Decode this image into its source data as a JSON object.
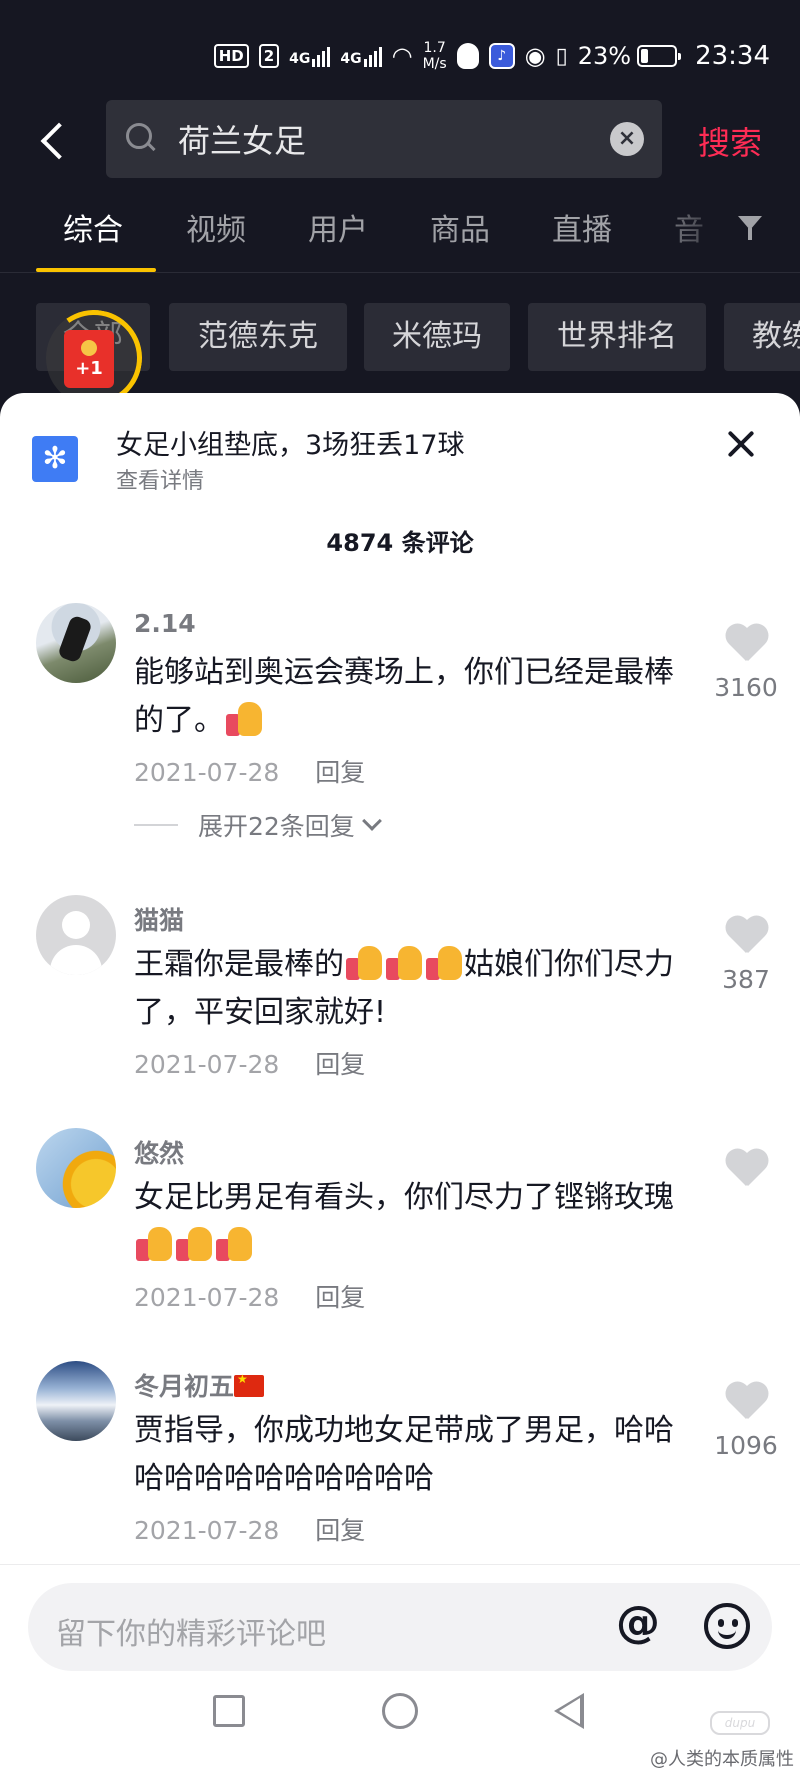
{
  "status_bar": {
    "hd": "HD",
    "sim": "2",
    "sig1": "4G",
    "sig2": "4G",
    "speed_val": "1.7",
    "speed_unit": "M/s",
    "battery": "23%",
    "battery_level": 0.23,
    "time": "23:34"
  },
  "search": {
    "query": "荷兰女足",
    "button_label": "搜索"
  },
  "tabs": [
    {
      "label": "综合",
      "active": true
    },
    {
      "label": "视频"
    },
    {
      "label": "用户"
    },
    {
      "label": "商品"
    },
    {
      "label": "直播"
    },
    {
      "label": "音"
    }
  ],
  "chips": [
    "全部",
    "范德东克",
    "米德玛",
    "世界排名",
    "教练"
  ],
  "red_packet": {
    "label": "+1"
  },
  "sheet": {
    "topic_title": "女足小组垫底，3场狂丢17球",
    "topic_sub": "查看详情",
    "comment_count": "4874 条评论",
    "comments": [
      {
        "user": "2.14",
        "text": "能够站到奥运会赛场上，你们已经是最棒的了。",
        "date": "2021-07-28",
        "reply": "回复",
        "likes": "3160",
        "expand": "展开22条回复"
      },
      {
        "user": "猫猫",
        "text_a": "王霜你是最棒的",
        "text_b": "姑娘们你们尽力了，平安回家就好!",
        "date": "2021-07-28",
        "reply": "回复",
        "likes": "387"
      },
      {
        "user": "悠然",
        "text": "女足比男足有看头，你们尽力了铿锵玫瑰",
        "date": "2021-07-28",
        "reply": "回复",
        "likes": ""
      },
      {
        "user": "冬月初五",
        "text": "贾指导，你成功地女足带成了男足，哈哈哈哈哈哈哈哈哈哈哈哈",
        "date": "2021-07-28",
        "reply": "回复",
        "likes": "1096"
      }
    ]
  },
  "input": {
    "placeholder": "留下你的精彩评论吧",
    "at": "@"
  },
  "watermark": {
    "logo": "dupu",
    "text": "@人类的本质属性"
  },
  "colors": {
    "accent": "#fe2c55",
    "tab_indicator": "#fac300",
    "topic_icon": "#3f7cf4"
  }
}
